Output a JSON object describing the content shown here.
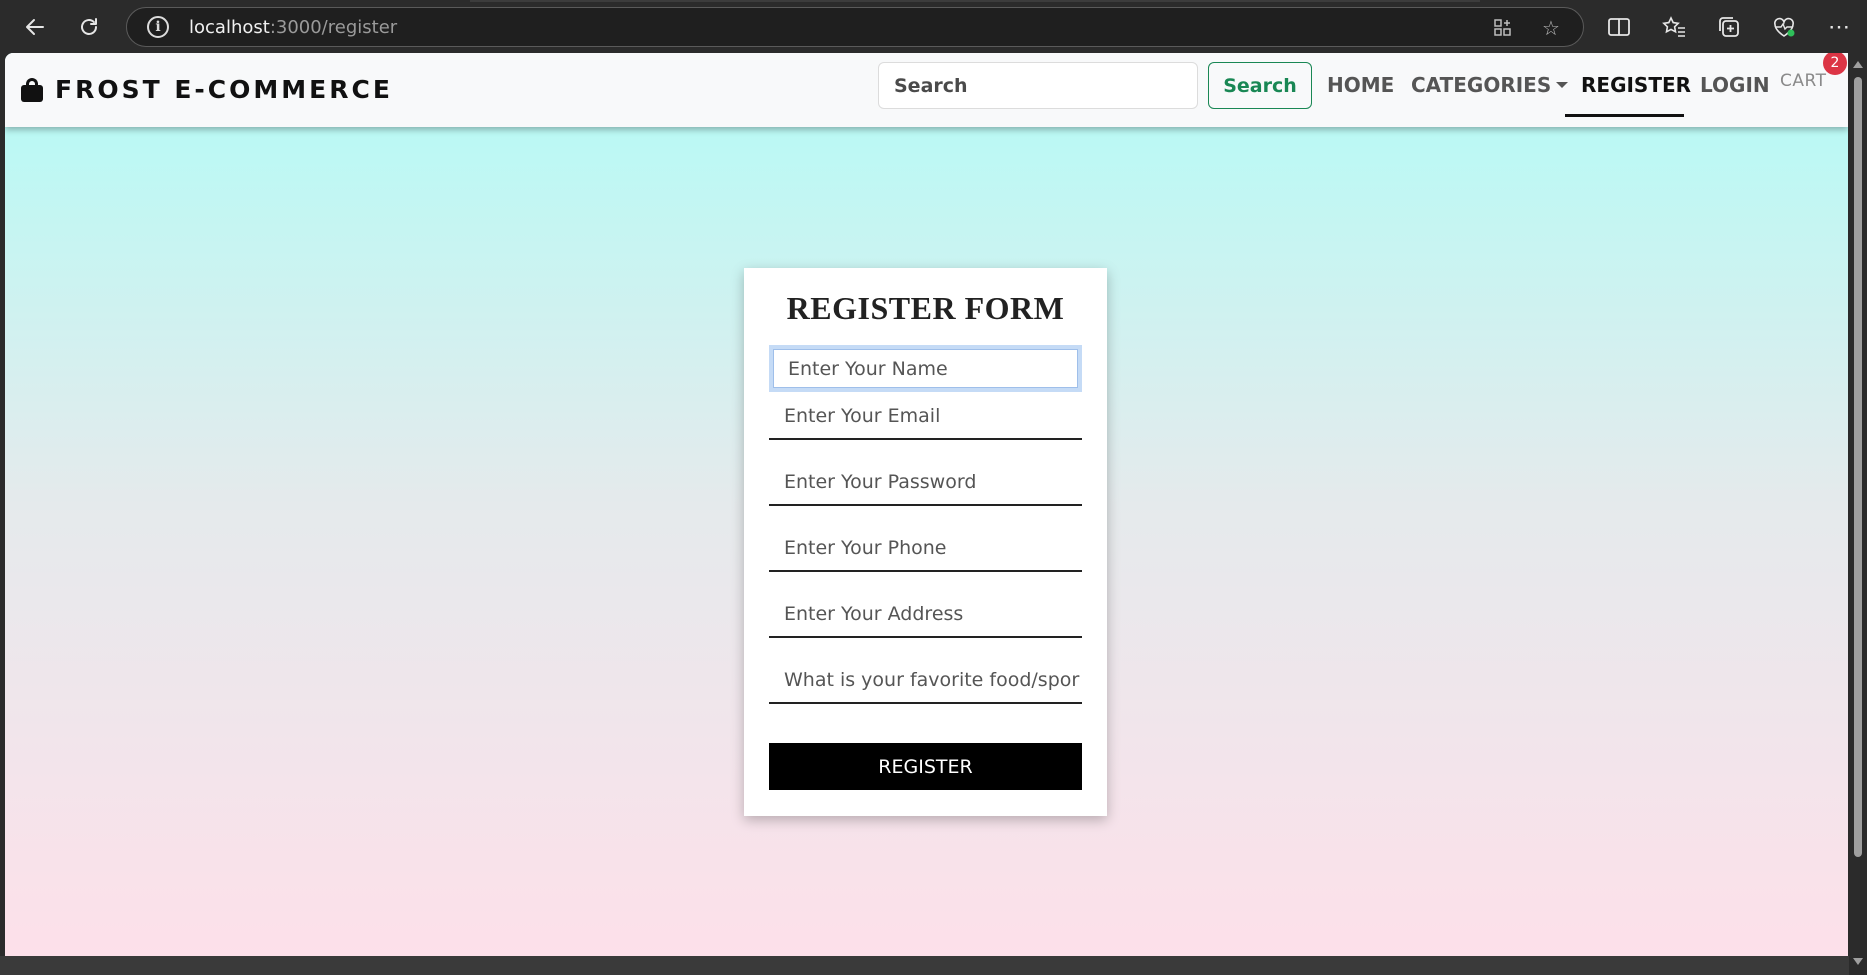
{
  "browser": {
    "url_host": "localhost",
    "url_rest": ":3000/register",
    "icons": {
      "back": "arrow-left-icon",
      "refresh": "refresh-icon",
      "info": "info-icon",
      "app": "app-grid-icon",
      "favorite": "star-icon",
      "split": "split-screen-icon",
      "favorites": "favorites-icon",
      "collections": "collections-icon",
      "health": "heart-pulse-icon",
      "more": "more-icon"
    }
  },
  "header": {
    "brand": "FROST E-COMMERCE",
    "search_placeholder": "Search",
    "search_button": "Search",
    "nav": {
      "home": "HOME",
      "categories": "CATEGORIES",
      "register": "REGISTER",
      "login": "LOGIN",
      "cart": "CART",
      "cart_count": "2"
    }
  },
  "form": {
    "title": "REGISTER FORM",
    "fields": {
      "name": "Enter Your Name",
      "email": "Enter Your Email",
      "password": "Enter Your Password",
      "phone": "Enter Your Phone",
      "address": "Enter Your Address",
      "answer": "What is your favorite food/sport"
    },
    "submit": "REGISTER"
  },
  "colors": {
    "gradient_top": "#b2fcf6",
    "gradient_bottom": "#fde0ea",
    "search_accent": "#198754",
    "badge": "#dc3545"
  }
}
